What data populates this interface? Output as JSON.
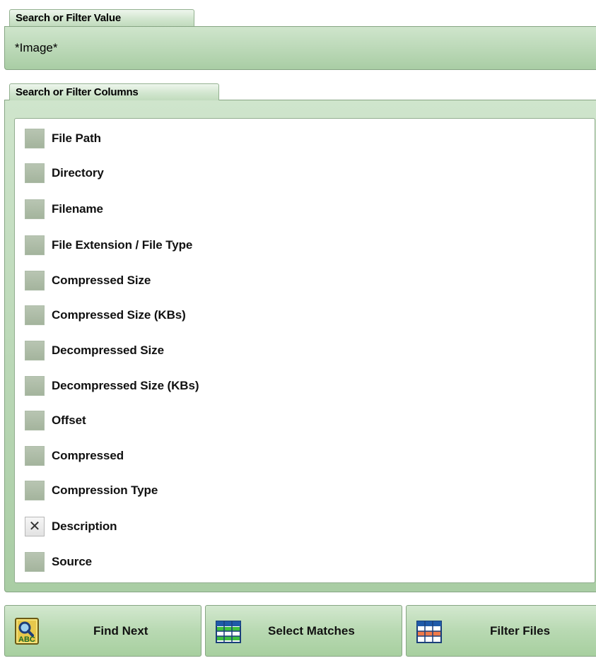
{
  "search_value": {
    "tab_label": "Search or Filter Value",
    "value": "*Image*"
  },
  "search_columns": {
    "tab_label": "Search or Filter Columns",
    "items": [
      {
        "label": "File Path",
        "checked": false
      },
      {
        "label": "Directory",
        "checked": false
      },
      {
        "label": "Filename",
        "checked": false
      },
      {
        "label": "File Extension / File Type",
        "checked": false
      },
      {
        "label": "Compressed Size",
        "checked": false
      },
      {
        "label": "Compressed Size (KBs)",
        "checked": false
      },
      {
        "label": "Decompressed Size",
        "checked": false
      },
      {
        "label": "Decompressed Size (KBs)",
        "checked": false
      },
      {
        "label": "Offset",
        "checked": false
      },
      {
        "label": "Compressed",
        "checked": false
      },
      {
        "label": "Compression Type",
        "checked": false
      },
      {
        "label": "Description",
        "checked": true
      },
      {
        "label": "Source",
        "checked": false
      }
    ]
  },
  "buttons": {
    "find_next": {
      "label": "Find Next",
      "icon": "find-abc-icon"
    },
    "select_matches": {
      "label": "Select Matches",
      "icon": "table-select-icon"
    },
    "filter_files": {
      "label": "Filter Files",
      "icon": "table-filter-icon"
    }
  },
  "colors": {
    "panel_green": "#b9d8b4",
    "tab_green": "#d2e6cf",
    "border_green": "#86a583"
  }
}
